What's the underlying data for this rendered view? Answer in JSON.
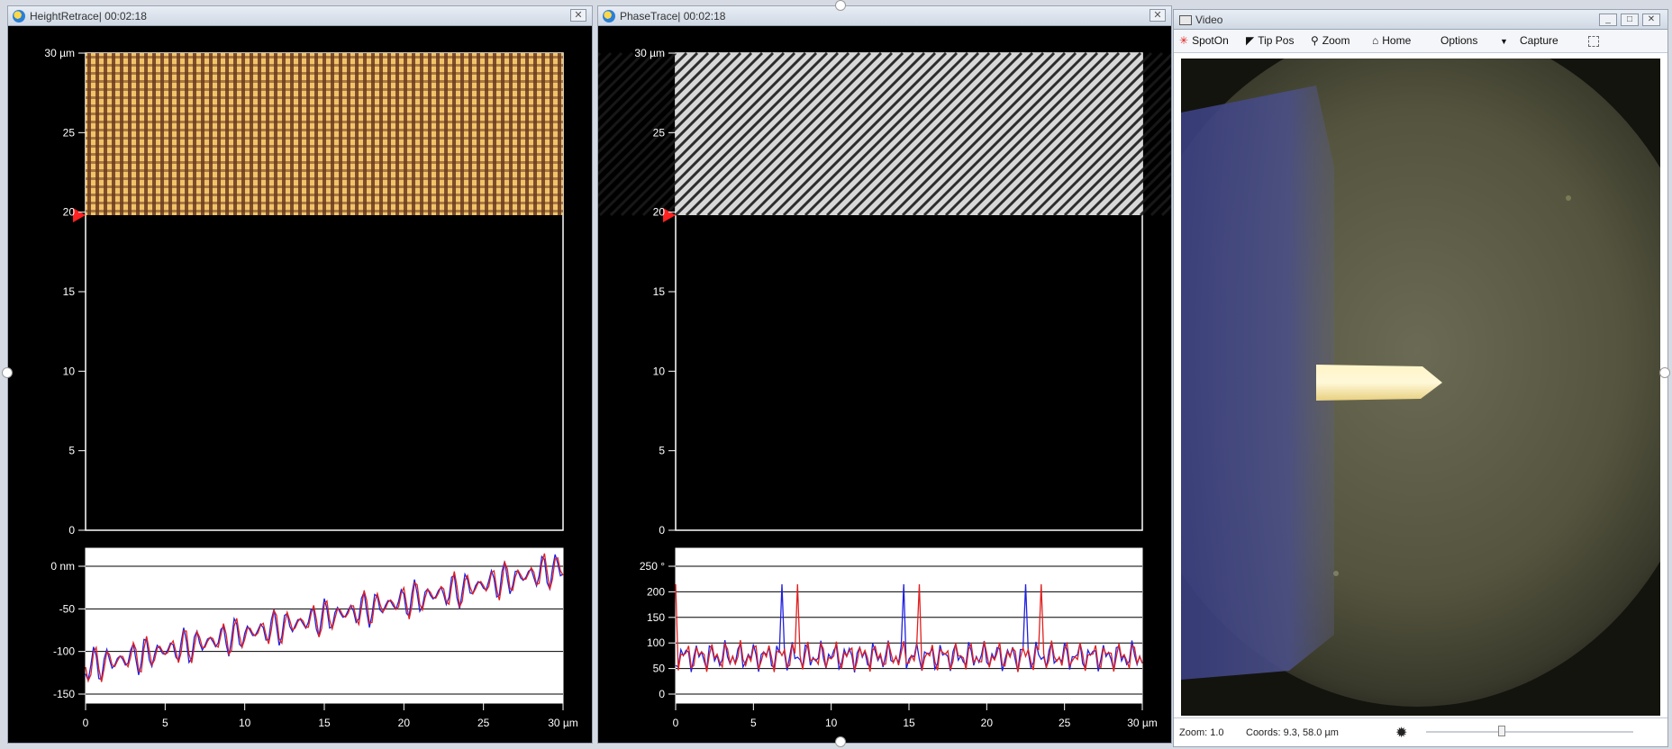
{
  "panes": {
    "height": {
      "title": "HeightRetrace| 00:02:18",
      "close_glyph": "✕",
      "image_y_ticks": [
        "30 µm",
        "25",
        "20",
        "15",
        "10",
        "5",
        "0"
      ],
      "profile_y_ticks": [
        "0 nm",
        "-50",
        "-100",
        "-150"
      ],
      "x_ticks": [
        "0",
        "5",
        "10",
        "15",
        "20",
        "25",
        "30 µm"
      ],
      "colors": {
        "image_a": "#f2c46a",
        "image_b": "#6a3a1e",
        "trace": "#e02020",
        "retrace": "#2020e0",
        "marker": "#ff2020"
      }
    },
    "phase": {
      "title": "PhaseTrace| 00:02:18",
      "close_glyph": "✕",
      "image_y_ticks": [
        "30 µm",
        "25",
        "20",
        "15",
        "10",
        "5",
        "0"
      ],
      "profile_y_ticks": [
        "250 °",
        "200",
        "150",
        "100",
        "50",
        "0"
      ],
      "x_ticks": [
        "0",
        "5",
        "10",
        "15",
        "20",
        "25",
        "30 µm"
      ],
      "colors": {
        "image_a": "#d8d8d8",
        "image_b": "#1a1a1a",
        "trace": "#e02020",
        "retrace": "#2020e0",
        "marker": "#ff2020"
      }
    }
  },
  "video": {
    "title": "Video",
    "toolbar": {
      "spoton": "SpotOn",
      "tippos": "Tip Pos",
      "zoom": "Zoom",
      "home": "Home",
      "options": "Options",
      "capture": "Capture"
    },
    "status": {
      "zoom": "Zoom: 1.0",
      "coords": "Coords: 9.3, 58.0 µm"
    },
    "window_buttons": [
      "_",
      "□",
      "✕"
    ]
  }
}
